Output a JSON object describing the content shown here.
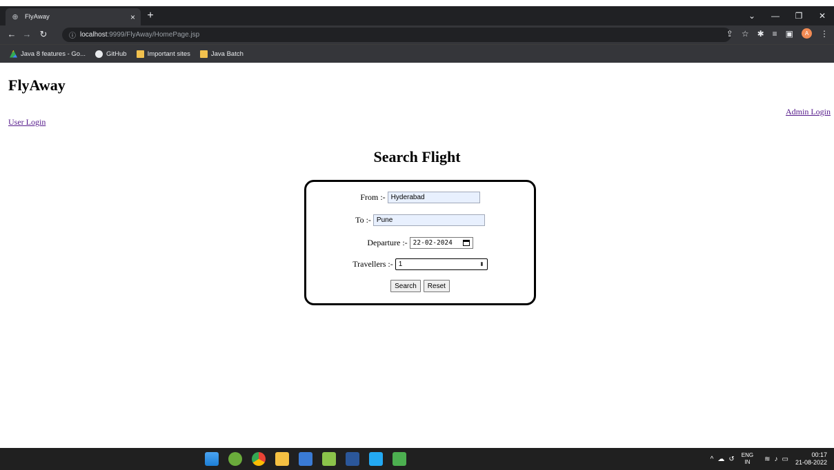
{
  "browser": {
    "tab_title": "FlyAway",
    "tab_close": "×",
    "new_tab": "+",
    "url_host": "localhost",
    "url_rest": ":9999/FlyAway/HomePage.jsp",
    "bookmarks": [
      {
        "label": "Java 8 features - Go...",
        "icon": "google-drive-icon"
      },
      {
        "label": "GitHub",
        "icon": "github-icon"
      },
      {
        "label": "Important sites",
        "icon": "folder-icon"
      },
      {
        "label": "Java Batch",
        "icon": "folder-icon"
      }
    ],
    "avatar_letter": "A"
  },
  "page": {
    "brand": "FlyAway",
    "user_login": "User Login",
    "admin_login": "Admin Login",
    "search_title": "Search Flight",
    "form": {
      "from_label": "From :-",
      "from_value": "Hyderabad",
      "to_label": "To :-",
      "to_value": "Pune",
      "departure_label": "Departure :-",
      "departure_value": "22-02-2024",
      "travellers_label": "Travellers :-",
      "travellers_value": "1",
      "search_button": "Search",
      "reset_button": "Reset"
    }
  },
  "taskbar": {
    "lang_top": "ENG",
    "lang_bottom": "IN",
    "time": "00:17",
    "date": "21-08-2022"
  }
}
